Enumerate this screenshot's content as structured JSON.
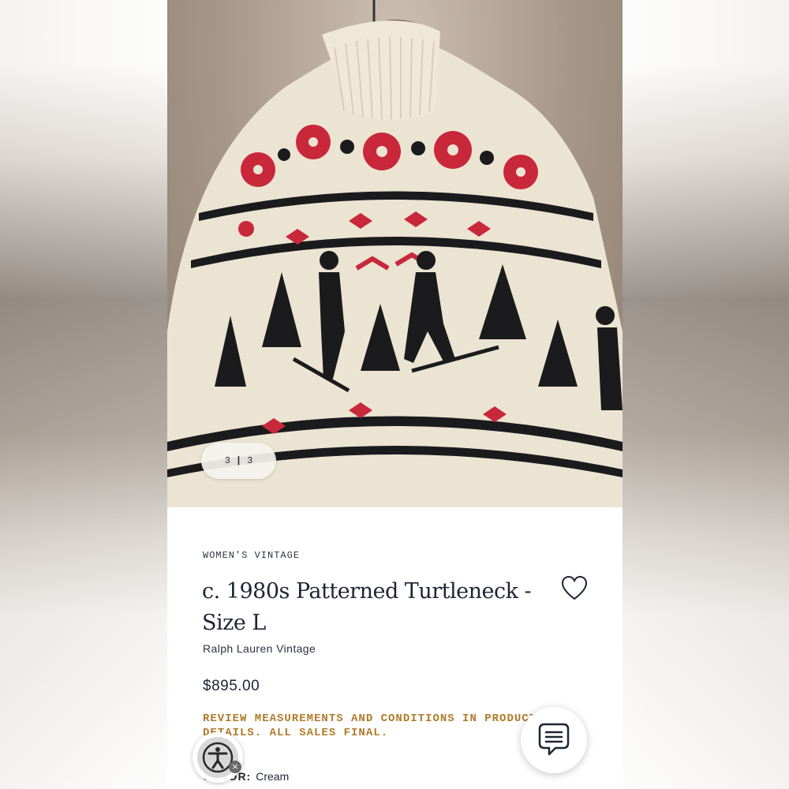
{
  "gallery": {
    "current": "3",
    "separator": "|",
    "total": "3"
  },
  "product": {
    "category": "WOMEN'S VINTAGE",
    "title": "c. 1980s Patterned Turtleneck - Size L",
    "brand": "Ralph Lauren Vintage",
    "price": "$895.00",
    "notice": "REVIEW MEASUREMENTS AND CONDITIONS IN PRODUCT DETAILS. ALL SALES FINAL.",
    "color_label": "COLOR:",
    "color_value": "Cream"
  },
  "icons": {
    "wishlist": "heart-outline-icon",
    "chat": "chat-bubble-icon",
    "accessibility": "accessibility-person-icon",
    "close": "close-icon"
  },
  "colors": {
    "notice": "#b07a2a",
    "text": "#1d2433",
    "sweater_base": "#ece4d2",
    "sweater_red": "#c8283a",
    "sweater_black": "#1b1b1d"
  }
}
